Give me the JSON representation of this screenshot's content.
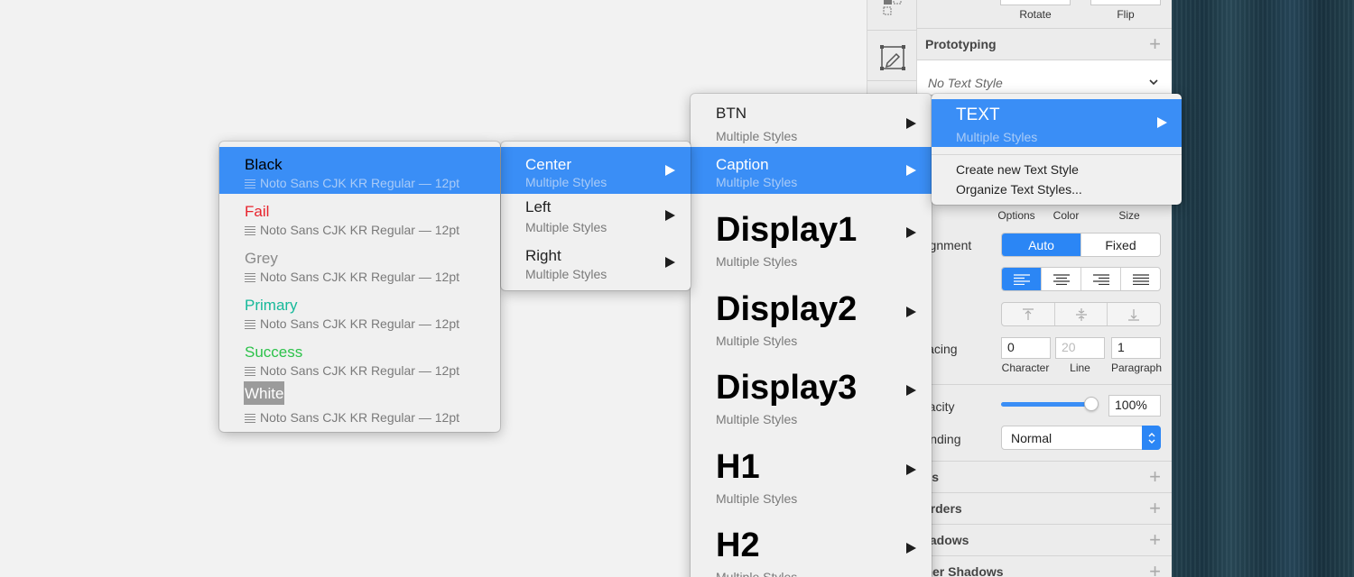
{
  "inspector": {
    "rotate_label": "Rotate",
    "flip_label": "Flip",
    "prototyping_title": "Prototyping",
    "text_style_placeholder": "No Text Style",
    "options_label": "Options",
    "color_label": "Color",
    "size_label": "Size",
    "alignment_label": "Alignment",
    "alignment_auto": "Auto",
    "alignment_fixed": "Fixed",
    "spacing_label": "Spacing",
    "character_value": "0",
    "line_value": "20",
    "paragraph_value": "1",
    "character_label": "Character",
    "line_label": "Line",
    "paragraph_label": "Paragraph",
    "opacity_label": "Opacity",
    "opacity_value": "100%",
    "opacity_level": 1.0,
    "blending_label": "Blending",
    "blending_value": "Normal",
    "sections": [
      "Fills",
      "Borders",
      "Shadows",
      "Inner Shadows"
    ]
  },
  "menu_top": {
    "text_item": {
      "label": "TEXT",
      "sub": "Multiple Styles"
    },
    "create_label": "Create new Text Style",
    "organize_label": "Organize Text Styles..."
  },
  "menu_styles": {
    "items": [
      {
        "label": "BTN",
        "sub": "Multiple Styles"
      },
      {
        "label": "Caption",
        "sub": "Multiple Styles"
      },
      {
        "label": "Display1",
        "sub": "Multiple Styles"
      },
      {
        "label": "Display2",
        "sub": "Multiple Styles"
      },
      {
        "label": "Display3",
        "sub": "Multiple Styles"
      },
      {
        "label": "H1",
        "sub": "Multiple Styles"
      },
      {
        "label": "H2",
        "sub": "Multiple Styles"
      }
    ]
  },
  "menu_align": {
    "items": [
      {
        "label": "Center",
        "sub": "Multiple Styles"
      },
      {
        "label": "Left",
        "sub": "Multiple Styles"
      },
      {
        "label": "Right",
        "sub": "Multiple Styles"
      }
    ]
  },
  "menu_colors": {
    "items": [
      {
        "label": "Black",
        "sub": "Noto Sans CJK KR Regular — 12pt",
        "color": "#000000"
      },
      {
        "label": "Fail",
        "sub": "Noto Sans CJK KR Regular — 12pt",
        "color": "#e8232d"
      },
      {
        "label": "Grey",
        "sub": "Noto Sans CJK KR Regular — 12pt",
        "color": "#8a8a8a"
      },
      {
        "label": "Primary",
        "sub": "Noto Sans CJK KR Regular — 12pt",
        "color": "#16b99a"
      },
      {
        "label": "Success",
        "sub": "Noto Sans CJK KR Regular — 12pt",
        "color": "#2cc24a"
      },
      {
        "label": "White",
        "sub": "Noto Sans CJK KR Regular — 12pt",
        "color": "#ffffff"
      }
    ]
  },
  "colors": {
    "highlight": "#3a8ef6",
    "accent": "#2b86f5"
  }
}
